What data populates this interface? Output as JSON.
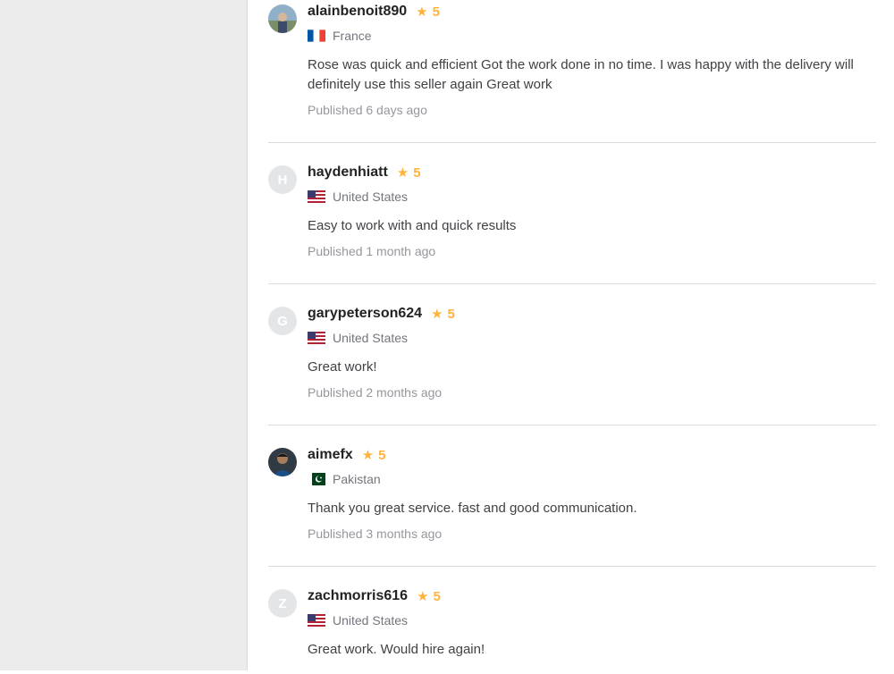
{
  "reviews": [
    {
      "username": "alainbenoit890",
      "rating": "5",
      "country": "France",
      "flag": "fr",
      "avatar_letter": "",
      "avatar_icon": "profile-photo-icon",
      "text": "Rose was quick and efficient Got the work done in no time. I was happy with the delivery will definitely use this seller again Great work",
      "published": "Published 6 days ago"
    },
    {
      "username": "haydenhiatt",
      "rating": "5",
      "country": "United States",
      "flag": "us",
      "avatar_letter": "H",
      "text": "Easy to work with and quick results",
      "published": "Published 1 month ago"
    },
    {
      "username": "garypeterson624",
      "rating": "5",
      "country": "United States",
      "flag": "us",
      "avatar_letter": "G",
      "text": "Great work!",
      "published": "Published 2 months ago"
    },
    {
      "username": "aimefx",
      "rating": "5",
      "country": "Pakistan",
      "flag": "pk",
      "avatar_letter": "",
      "avatar_icon": "profile-photo-icon",
      "text": "Thank you great service. fast and good communication.",
      "published": "Published 3 months ago"
    },
    {
      "username": "zachmorris616",
      "rating": "5",
      "country": "United States",
      "flag": "us",
      "avatar_letter": "Z",
      "text": "Great work. Would hire again!",
      "published": ""
    }
  ],
  "colors": {
    "star": "#ffb33e",
    "username": "#222325",
    "meta": "#95979d",
    "left_panel": "#ececec"
  }
}
